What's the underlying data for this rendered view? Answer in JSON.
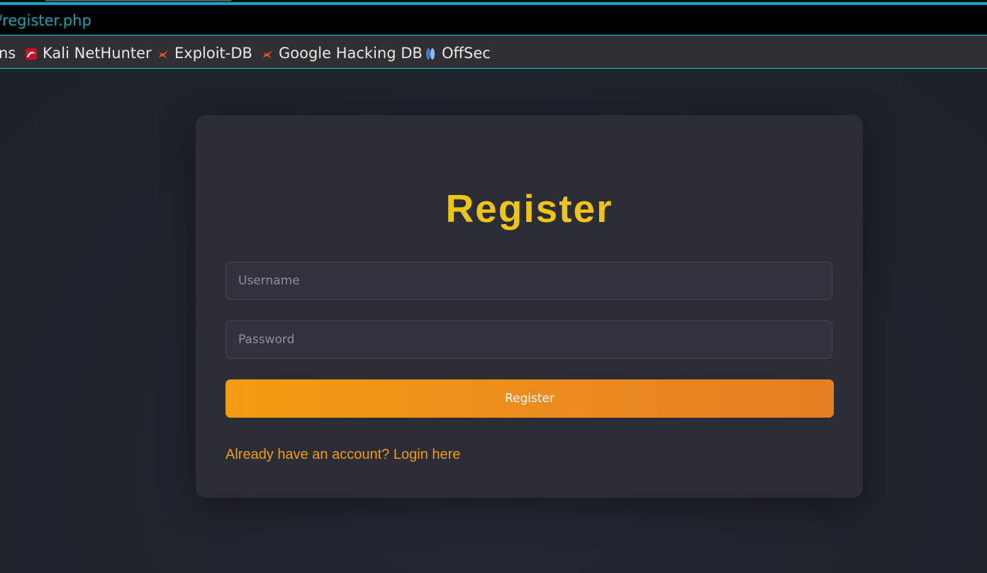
{
  "browser": {
    "url": "/register.php",
    "bookmarks": [
      {
        "label": "ns",
        "icon": "bookmark-partial"
      },
      {
        "label": "Kali NetHunter",
        "icon": "kali-nethunter-icon"
      },
      {
        "label": "Exploit-DB",
        "icon": "exploit-db-icon"
      },
      {
        "label": "Google Hacking DB",
        "icon": "exploit-db-icon"
      },
      {
        "label": "OffSec",
        "icon": "offsec-icon"
      }
    ]
  },
  "form": {
    "title": "Register",
    "username_placeholder": "Username",
    "password_placeholder": "Password",
    "submit_label": "Register",
    "login_link": "Already have an account? Login here"
  },
  "colors": {
    "accent": "#f39c12",
    "title": "#f1c40f",
    "card": "#2a2c36",
    "background": "#1f232c"
  }
}
